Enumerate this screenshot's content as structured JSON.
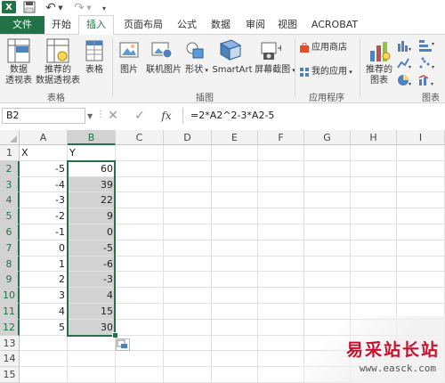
{
  "app": {
    "logo_text": "X",
    "tabs": [
      "文件",
      "开始",
      "插入",
      "页面布局",
      "公式",
      "数据",
      "审阅",
      "视图",
      "ACROBAT"
    ],
    "active_tab": "插入"
  },
  "ribbon": {
    "tables_group": {
      "label": "表格",
      "buttons": [
        {
          "label": "数据\n透视表",
          "icon": "pivot-table-icon"
        },
        {
          "label": "推荐的\n数据透视表",
          "icon": "recommended-pivot-icon"
        },
        {
          "label": "表格",
          "icon": "table-icon"
        }
      ]
    },
    "illustrations_group": {
      "label": "插图",
      "buttons": [
        {
          "label": "图片",
          "icon": "picture-icon"
        },
        {
          "label": "联机图片",
          "icon": "online-picture-icon"
        },
        {
          "label": "形状",
          "icon": "shapes-icon"
        },
        {
          "label": "SmartArt",
          "icon": "smartart-icon"
        },
        {
          "label": "屏幕截图",
          "icon": "screenshot-icon"
        }
      ]
    },
    "apps_group": {
      "label": "应用程序",
      "buttons": [
        {
          "label": "应用商店",
          "icon": "store-icon"
        },
        {
          "label": "我的应用",
          "icon": "my-apps-icon"
        }
      ]
    },
    "charts_group": {
      "label": "图表",
      "buttons": [
        {
          "label": "推荐的\n图表",
          "icon": "recommended-chart-icon"
        }
      ]
    }
  },
  "formula_bar": {
    "name_box": "B2",
    "formula": "=2*A2^2-3*A2-5"
  },
  "sheet": {
    "columns": [
      "A",
      "B",
      "C",
      "D",
      "E",
      "F",
      "G",
      "H",
      "I"
    ],
    "selected_column": "B",
    "rows": [
      "1",
      "2",
      "3",
      "4",
      "5",
      "6",
      "7",
      "8",
      "9",
      "10",
      "11",
      "12",
      "13",
      "14",
      "15"
    ],
    "header_row": {
      "A": "X",
      "B": "Y"
    },
    "data": [
      {
        "x": "-5",
        "y": "60"
      },
      {
        "x": "-4",
        "y": "39"
      },
      {
        "x": "-3",
        "y": "22"
      },
      {
        "x": "-2",
        "y": "9"
      },
      {
        "x": "-1",
        "y": "0"
      },
      {
        "x": "0",
        "y": "-5"
      },
      {
        "x": "1",
        "y": "-6"
      },
      {
        "x": "2",
        "y": "-3"
      },
      {
        "x": "3",
        "y": "4"
      },
      {
        "x": "4",
        "y": "15"
      },
      {
        "x": "5",
        "y": "30"
      }
    ]
  },
  "colors": {
    "accent": "#217346",
    "selection": "#d2d2d2",
    "watermark": "#c8102e"
  },
  "watermark": {
    "logo": "易采站长站",
    "url": "www.easck.com"
  }
}
